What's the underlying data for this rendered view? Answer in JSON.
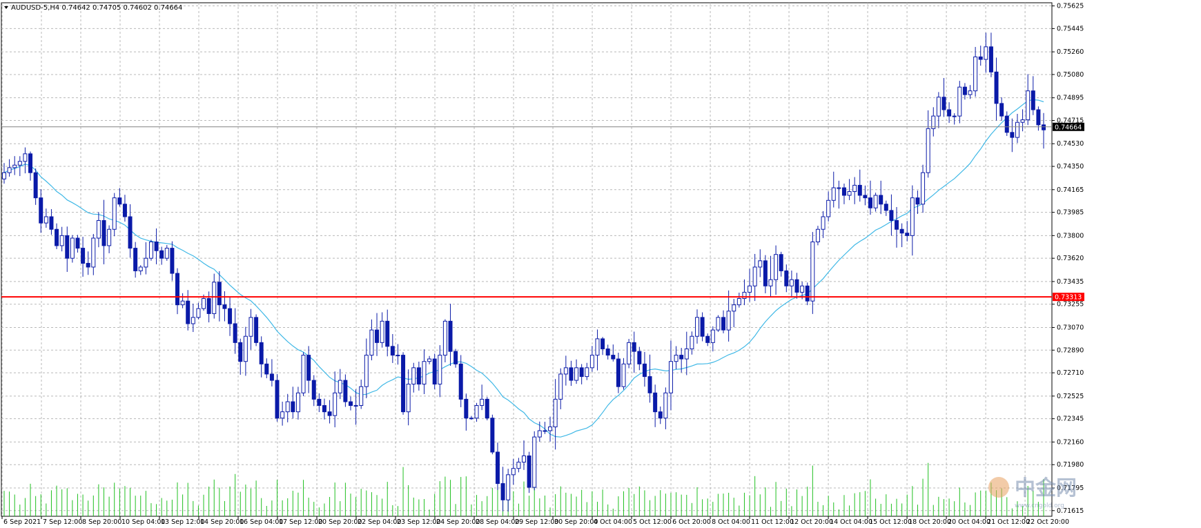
{
  "header": {
    "symbol_line": "AUDUSD-5,H4  0.74642 0.74705 0.74602 0.74664"
  },
  "watermark": {
    "text": "中金网",
    "url": "www.cngold.org"
  },
  "colors": {
    "bull_body": "#ffffff",
    "bear_body": "#0a1aa8",
    "candle_outline": "#0a1aa8",
    "ma_line": "#3fb8e6",
    "volume": "#20c020",
    "support_line": "#ff0000",
    "grid": "#b8b8b8",
    "axis_text": "#000000"
  },
  "chart_data": {
    "type": "candlestick",
    "symbol": "AUDUSD-5",
    "timeframe": "H4",
    "last_bar": {
      "open": 0.74642,
      "high": 0.74705,
      "low": 0.74602,
      "close": 0.74664
    },
    "current_price_label": "0.74664",
    "horizontal_line_label": "0.73313",
    "horizontal_line_value": 0.73313,
    "y_ticks": [
      "0.75625",
      "0.75445",
      "0.75260",
      "0.75080",
      "0.74895",
      "0.74715",
      "0.74530",
      "0.74350",
      "0.74165",
      "0.73985",
      "0.73800",
      "0.73620",
      "0.73435",
      "0.73255",
      "0.73070",
      "0.72890",
      "0.72710",
      "0.72525",
      "0.72345",
      "0.72160",
      "0.71980",
      "0.71795",
      "0.71615"
    ],
    "y_range": [
      0.7157,
      0.7565
    ],
    "x_ticks": [
      "6 Sep 2021",
      "7 Sep 12:00",
      "8 Sep 20:00",
      "10 Sep 04:00",
      "13 Sep 12:00",
      "14 Sep 20:00",
      "16 Sep 04:00",
      "17 Sep 12:00",
      "20 Sep 20:00",
      "22 Sep 04:00",
      "23 Sep 12:00",
      "24 Sep 20:00",
      "28 Sep 04:00",
      "29 Sep 12:00",
      "30 Sep 20:00",
      "4 Oct 04:00",
      "5 Oct 12:00",
      "6 Oct 20:00",
      "8 Oct 04:00",
      "11 Oct 12:00",
      "12 Oct 20:00",
      "14 Oct 04:00",
      "15 Oct 12:00",
      "18 Oct 20:00",
      "20 Oct 04:00",
      "21 Oct 12:00",
      "22 Oct 20:00"
    ],
    "close": [
      0.743,
      0.7434,
      0.7436,
      0.7439,
      0.7445,
      0.743,
      0.741,
      0.739,
      0.7395,
      0.7385,
      0.7372,
      0.738,
      0.7362,
      0.7378,
      0.737,
      0.7358,
      0.7355,
      0.7378,
      0.7392,
      0.7372,
      0.7385,
      0.741,
      0.7405,
      0.7395,
      0.737,
      0.7352,
      0.7355,
      0.7362,
      0.7375,
      0.7368,
      0.7362,
      0.737,
      0.735,
      0.7325,
      0.7328,
      0.731,
      0.7315,
      0.7322,
      0.733,
      0.7318,
      0.7343,
      0.7325,
      0.7322,
      0.731,
      0.7295,
      0.728,
      0.73,
      0.7315,
      0.7295,
      0.7278,
      0.727,
      0.7265,
      0.7235,
      0.724,
      0.7248,
      0.724,
      0.7255,
      0.7285,
      0.7265,
      0.725,
      0.7245,
      0.724,
      0.7237,
      0.7255,
      0.7265,
      0.7248,
      0.7245,
      0.7245,
      0.726,
      0.7285,
      0.7305,
      0.7295,
      0.7312,
      0.7292,
      0.7285,
      0.7285,
      0.724,
      0.7262,
      0.7275,
      0.7262,
      0.728,
      0.7282,
      0.7262,
      0.7285,
      0.7312,
      0.7288,
      0.7278,
      0.725,
      0.7235,
      0.7235,
      0.7245,
      0.725,
      0.7235,
      0.7208,
      0.7183,
      0.717,
      0.719,
      0.7195,
      0.72,
      0.7205,
      0.718,
      0.722,
      0.7225,
      0.7225,
      0.7228,
      0.725,
      0.727,
      0.7275,
      0.7265,
      0.7275,
      0.7268,
      0.7275,
      0.7285,
      0.7298,
      0.729,
      0.7285,
      0.7282,
      0.726,
      0.7278,
      0.7295,
      0.7288,
      0.7278,
      0.7268,
      0.7255,
      0.724,
      0.7235,
      0.7255,
      0.728,
      0.7285,
      0.7282,
      0.729,
      0.73,
      0.7315,
      0.73,
      0.7295,
      0.7305,
      0.7315,
      0.7305,
      0.732,
      0.7325,
      0.733,
      0.7335,
      0.734,
      0.7355,
      0.736,
      0.734,
      0.7345,
      0.7365,
      0.7352,
      0.734,
      0.7345,
      0.7335,
      0.734,
      0.7328,
      0.7375,
      0.7385,
      0.7395,
      0.7408,
      0.7418,
      0.7418,
      0.7412,
      0.7415,
      0.742,
      0.7412,
      0.741,
      0.7402,
      0.7412,
      0.7405,
      0.74,
      0.7392,
      0.7385,
      0.7382,
      0.738,
      0.741,
      0.7405,
      0.743,
      0.7465,
      0.7475,
      0.749,
      0.748,
      0.7475,
      0.7475,
      0.7498,
      0.7492,
      0.7495,
      0.7522,
      0.752,
      0.753,
      0.751,
      0.7485,
      0.7475,
      0.7462,
      0.7458,
      0.747,
      0.7472,
      0.7495,
      0.748,
      0.7468,
      0.7464
    ]
  },
  "volume_note": "volume histogram"
}
